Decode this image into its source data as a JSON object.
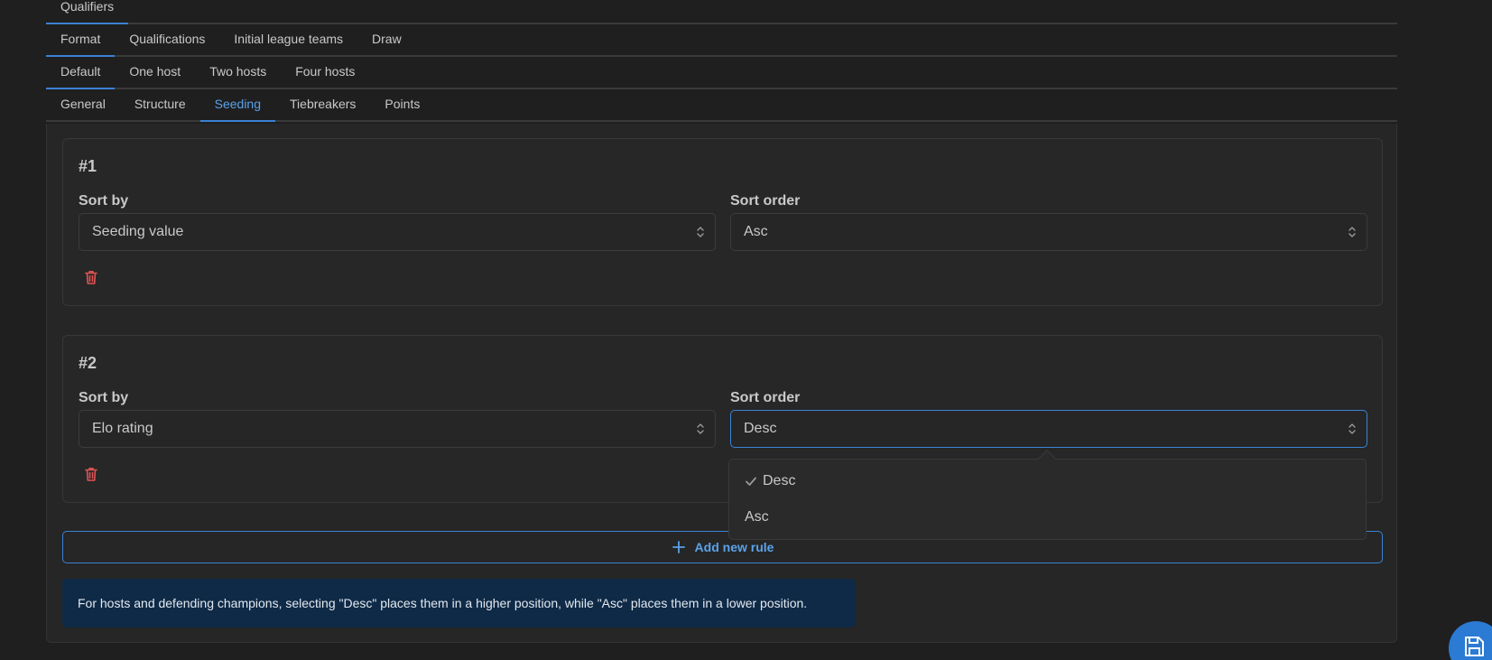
{
  "tabs": {
    "level0": [
      {
        "label": "Qualifiers",
        "active": true
      }
    ],
    "level1": [
      {
        "label": "Format",
        "active": true
      },
      {
        "label": "Qualifications"
      },
      {
        "label": "Initial league teams"
      },
      {
        "label": "Draw"
      }
    ],
    "level2": [
      {
        "label": "Default",
        "active": true
      },
      {
        "label": "One host"
      },
      {
        "label": "Two hosts"
      },
      {
        "label": "Four hosts"
      }
    ],
    "level3": [
      {
        "label": "General"
      },
      {
        "label": "Structure"
      },
      {
        "label": "Seeding",
        "active": true
      },
      {
        "label": "Tiebreakers"
      },
      {
        "label": "Points"
      }
    ]
  },
  "rules": [
    {
      "title": "#1",
      "sort_by_label": "Sort by",
      "sort_by_value": "Seeding value",
      "sort_order_label": "Sort order",
      "sort_order_value": "Asc"
    },
    {
      "title": "#2",
      "sort_by_label": "Sort by",
      "sort_by_value": "Elo rating",
      "sort_order_label": "Sort order",
      "sort_order_value": "Desc"
    }
  ],
  "dropdown": {
    "options": [
      "Desc",
      "Asc"
    ],
    "selected": "Desc"
  },
  "add_rule_label": "Add new rule",
  "note": "For hosts and defending champions, selecting \"Desc\" places them in a higher position, while \"Asc\" places them in a lower position.",
  "colors": {
    "accent": "#3b82d6",
    "danger": "#e05454",
    "note_bg": "#0f2a47"
  },
  "icons": {
    "delete": "trash-icon",
    "add": "plus-icon",
    "select": "chevron-updown-icon",
    "selected": "check-icon",
    "save": "save-icon"
  }
}
